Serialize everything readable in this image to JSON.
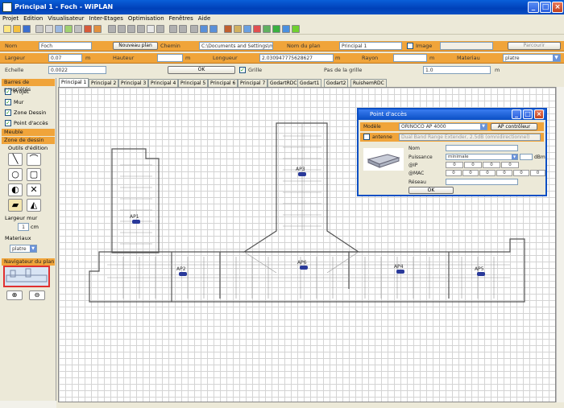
{
  "window": {
    "title": "Principal 1 - Foch - WiPLAN"
  },
  "menu": [
    "Projet",
    "Edition",
    "Visualisateur",
    "Inter-Etages",
    "Optimisation",
    "Fenêtres",
    "Aide"
  ],
  "row1": {
    "nom_label": "Nom",
    "nom_value": "Foch",
    "nouveau_plan": "Nouveau plan",
    "chemin_label": "Chemin",
    "chemin_value": "C:\\Documents and Settings\\mgorc",
    "nom_plan_label": "Nom du plan",
    "nom_plan_value": "Principal 1",
    "image_label": "Image",
    "parcourir": "Parcourir"
  },
  "row2": {
    "largeur_label": "Largeur",
    "largeur_value": "0.07",
    "unit_m": "m",
    "hauteur_label": "Hauteur",
    "longueur_label": "Longueur",
    "longueur_value": "2.030947775628627",
    "rayon_label": "Rayon",
    "materiau_label": "Materiau",
    "materiau_value": "platre"
  },
  "row3": {
    "echelle_label": "Echelle",
    "echelle_value": "0.0022",
    "ok": "OK",
    "grille_label": "Grille",
    "pas_label": "Pas de la grille",
    "pas_value": "1.0",
    "unit_m": "m"
  },
  "left": {
    "barres_header": "Barres de propriétés",
    "checks": [
      "Projet",
      "Mur",
      "Zone Dessin",
      "Point d'accès"
    ],
    "meuble_header": "Meuble",
    "zone_header": "Zone de dessin",
    "outils_label": "Outils d'édition",
    "largeur_mur_label": "Largeur mur",
    "largeur_mur_value": "1",
    "largeur_mur_unit": "cm",
    "materiaux_label": "Materiaux",
    "materiaux_value": "platre",
    "navigateur_header": "Navigateur du plan"
  },
  "tabs": [
    "Principal 1",
    "Principal 2",
    "Principal 3",
    "Principal 4",
    "Principal 5",
    "Principal 6",
    "Principal 7",
    "GodartRDC",
    "Godart1",
    "Godart2",
    "RuishemRDC"
  ],
  "access_points": [
    "AP1",
    "AP2",
    "AP3",
    "AP4",
    "AP5",
    "AP6"
  ],
  "dialog": {
    "title": "Point d'accès",
    "modele_label": "Modèle",
    "modele_value": "ORINOCO AP 4000",
    "ap_controleur": "AP contrôleur",
    "antenne_label": "antenne",
    "antenne_value": "Dual Band Range Extender, 2.5dB (omnidirectionnel)",
    "nom_label": "Nom",
    "puissance_label": "Puissance",
    "puissance_value": "minimale",
    "dbm": "dBm",
    "ip_label": "@IP",
    "ip_values": [
      "0",
      "0",
      "0",
      "0"
    ],
    "mac_label": "@MAC",
    "mac_values": [
      "0",
      "0",
      "0",
      "0",
      "0",
      "0"
    ],
    "reseau_label": "Réseau",
    "ok": "OK"
  }
}
